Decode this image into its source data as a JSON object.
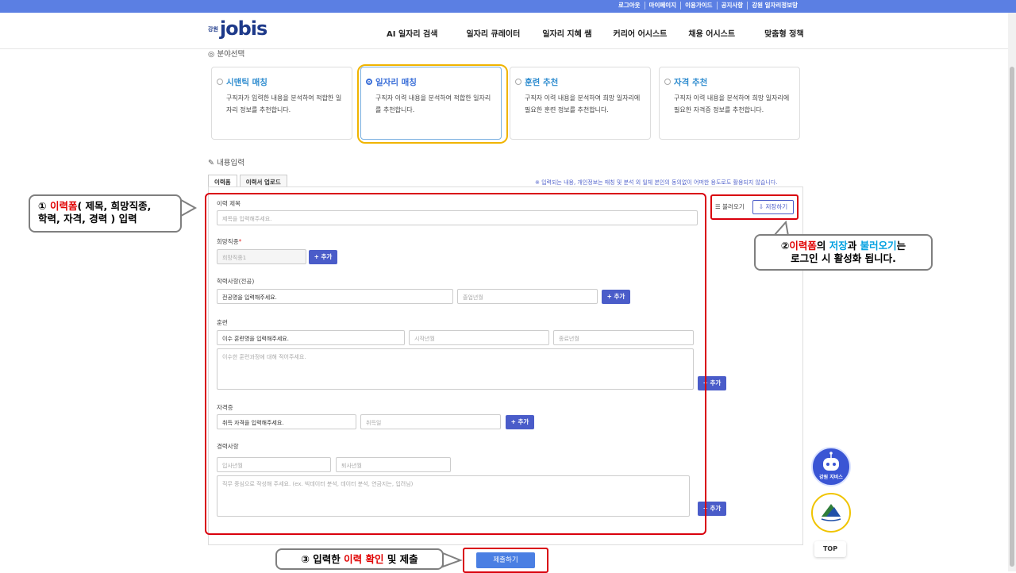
{
  "topbar": {
    "links": [
      "로그아웃",
      "마이페이지",
      "이용가이드",
      "공지사항",
      "강원 일자리정보망"
    ]
  },
  "header": {
    "logo_small": "강원",
    "logo_big": "jobis",
    "nav": [
      "AI 일자리 검색",
      "일자리 큐레이터",
      "일자리 지혜 쌤",
      "커리어 어시스트",
      "채용 어시스트",
      "맞춤형 정책"
    ]
  },
  "field_section": {
    "title": "분야선택"
  },
  "cards": [
    {
      "title": "시맨틱 매칭",
      "desc": "구직자가 입력한 내용을 분석하여 적합한 일자리 정보를 추천합니다.",
      "selected": false
    },
    {
      "title": "일자리 매칭",
      "desc": "구직자 이력 내용을 분석하여 적합한 일자리를 추천합니다.",
      "selected": true
    },
    {
      "title": "훈련 추천",
      "desc": "구직자 이력 내용을 분석하여 희망 일자리에 필요한 훈련 정보를 추천합니다.",
      "selected": false
    },
    {
      "title": "자격 추천",
      "desc": "구직자 이력 내용을 분석하여 희망 일자리에 필요한 자격증 정보를 추천합니다.",
      "selected": false
    }
  ],
  "content_section": {
    "title": "내용입력"
  },
  "tabs": [
    "이력폼",
    "이력서 업로드"
  ],
  "notice": "※ 입력되는 내용, 개인정보는 매칭 및 분석 외 일체 본인의 동의없이 어떠한 용도로도 활용되지 않습니다.",
  "form": {
    "title_label": "이력 제목",
    "title_placeholder": "제목을 입력해주세요.",
    "job_label": "희망직종",
    "job_req": "*",
    "job_placeholder": "희망직종1",
    "edu_label": "학력사항(전공)",
    "edu_major_value": "전공명을 입력해주세요.",
    "edu_year_placeholder": "졸업년월",
    "train_label": "훈련",
    "train_name_value": "이수 훈련명을 입력해주세요.",
    "train_start_placeholder": "시작년월",
    "train_end_placeholder": "종료년월",
    "train_desc_placeholder": "이수한 훈련과정에 대해 적어주세요.",
    "cert_label": "자격증",
    "cert_name_value": "취득 자격을 입력해주세요.",
    "cert_date_placeholder": "취득일",
    "career_label": "경력사항",
    "career_start_placeholder": "입사년월",
    "career_end_placeholder": "퇴사년월",
    "career_desc_placeholder": "직무 중심으로 작성해 주세요. (ex. 빅데이터 분석, 데이터 분석, 연금지는, 입려님)",
    "add_label": "+ 추가"
  },
  "actions": {
    "load": "불러오기",
    "save": "저장하기",
    "submit": "제출하기"
  },
  "callouts": {
    "c1_prefix": "① ",
    "c1_red": "이력폼",
    "c1_rest": "( 제목, 희망직종,",
    "c1_line2": "학력, 자격, 경력 ) 입력",
    "c2_prefix": "②",
    "c2_red": "이력폼",
    "c2_mid1": "의 ",
    "c2_blue1": "저장",
    "c2_mid2": "과 ",
    "c2_blue2": "불러오기",
    "c2_end": "는",
    "c2_line2": "로그인 시 활성화 됩니다.",
    "c3_prefix": "③ 입력한 ",
    "c3_red": "이력 확인",
    "c3_end": " 및 제출"
  },
  "floating": {
    "bot_label": "강원 지비스",
    "top_label": "TOP"
  },
  "colors": {
    "primary": "#4a5cc9",
    "topbar": "#5b7fe3",
    "highlight_red": "#d9000d",
    "selected_ring": "#f0b400"
  }
}
